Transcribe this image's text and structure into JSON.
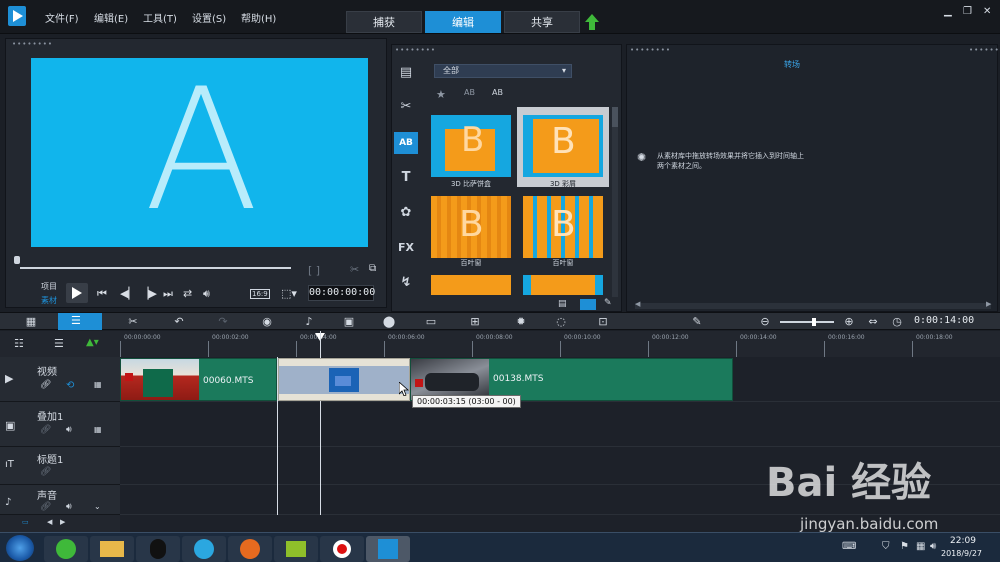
{
  "menu": {
    "file": "文件(F)",
    "edit": "编辑(E)",
    "tools": "工具(T)",
    "settings": "设置(S)",
    "help": "帮助(H)"
  },
  "tabs": {
    "capture": "捕获",
    "edit": "编辑",
    "share": "共享"
  },
  "preview": {
    "letter": "A",
    "project_label": "项目",
    "clip_label": "素材",
    "aspect": "16:9",
    "timecode": "00:00:00:00"
  },
  "library": {
    "filter": "全部",
    "items": [
      {
        "label": "3D 比萨饼盒"
      },
      {
        "label": "3D 彩屑"
      },
      {
        "label": "百叶窗"
      },
      {
        "label": "百叶窗"
      }
    ]
  },
  "options": {
    "title": "转场",
    "hint": "从素材库中拖放转场效果并将它插入到时间轴上两个素材之间。"
  },
  "toolbar": {
    "total_time": "0:00:14:00"
  },
  "timeline": {
    "ruler": [
      "00:00:00:00",
      "00:00:02:00",
      "00:00:04:00",
      "00:00:06:00",
      "00:00:08:00",
      "00:00:10:00",
      "00:00:12:00",
      "00:00:14:00",
      "00:00:16:00",
      "00:00:18:00"
    ],
    "tracks": [
      {
        "name": "视频"
      },
      {
        "name": "叠加1"
      },
      {
        "name": "标题1"
      },
      {
        "name": "声音"
      }
    ],
    "clips": [
      {
        "label": "00060.MTS"
      },
      {
        "label": "00138.MTS"
      }
    ],
    "tooltip": "00:00:03:15 (03:00 - 00)"
  },
  "taskbar": {
    "time": "22:09",
    "date": "2018/9/27"
  },
  "watermark": {
    "brand": "Bai 经验",
    "url": "jingyan.baidu.com"
  }
}
